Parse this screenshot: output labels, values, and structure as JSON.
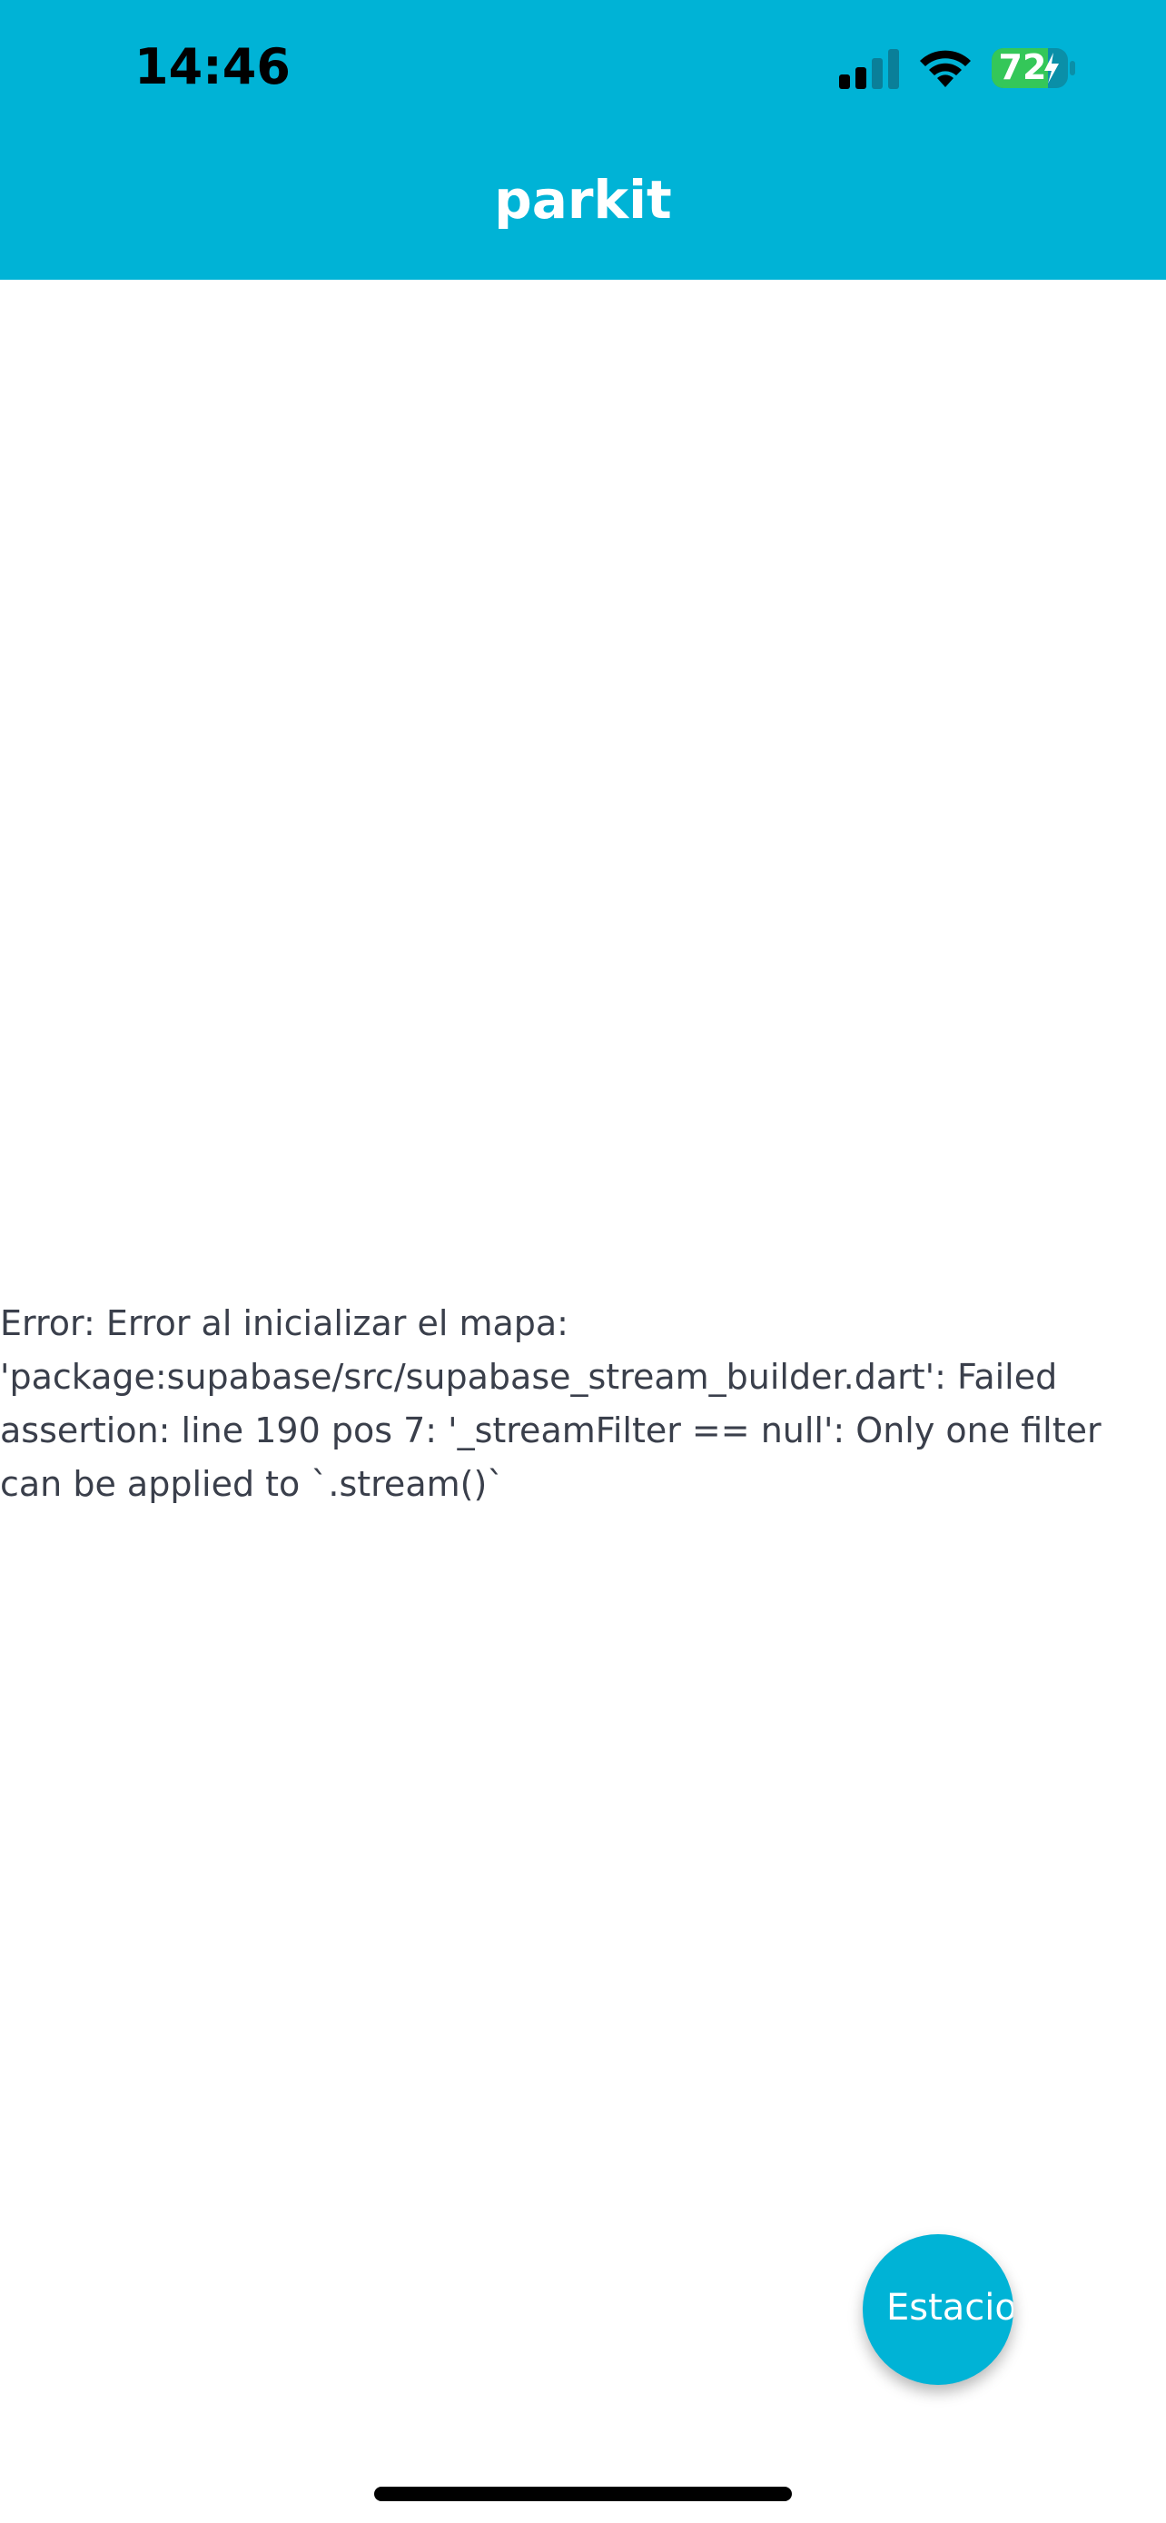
{
  "status_bar": {
    "time": "14:46",
    "battery_level": "72",
    "icons": {
      "signal": "cellular-signal-icon",
      "wifi": "wifi-icon",
      "battery": "battery-charging-icon"
    },
    "battery_color": "#34c759"
  },
  "app_bar": {
    "title": "parkit",
    "background_color": "#00b3d6"
  },
  "main": {
    "error_text": "Error: Error al inicializar el mapa: 'package:supabase/src/supabase_stream_builder.dart': Failed assertion: line 190 pos 7: '_streamFilter == null': Only one filter can be applied to `.stream()`"
  },
  "fab": {
    "label": "Estacio",
    "color": "#00b3d6"
  }
}
